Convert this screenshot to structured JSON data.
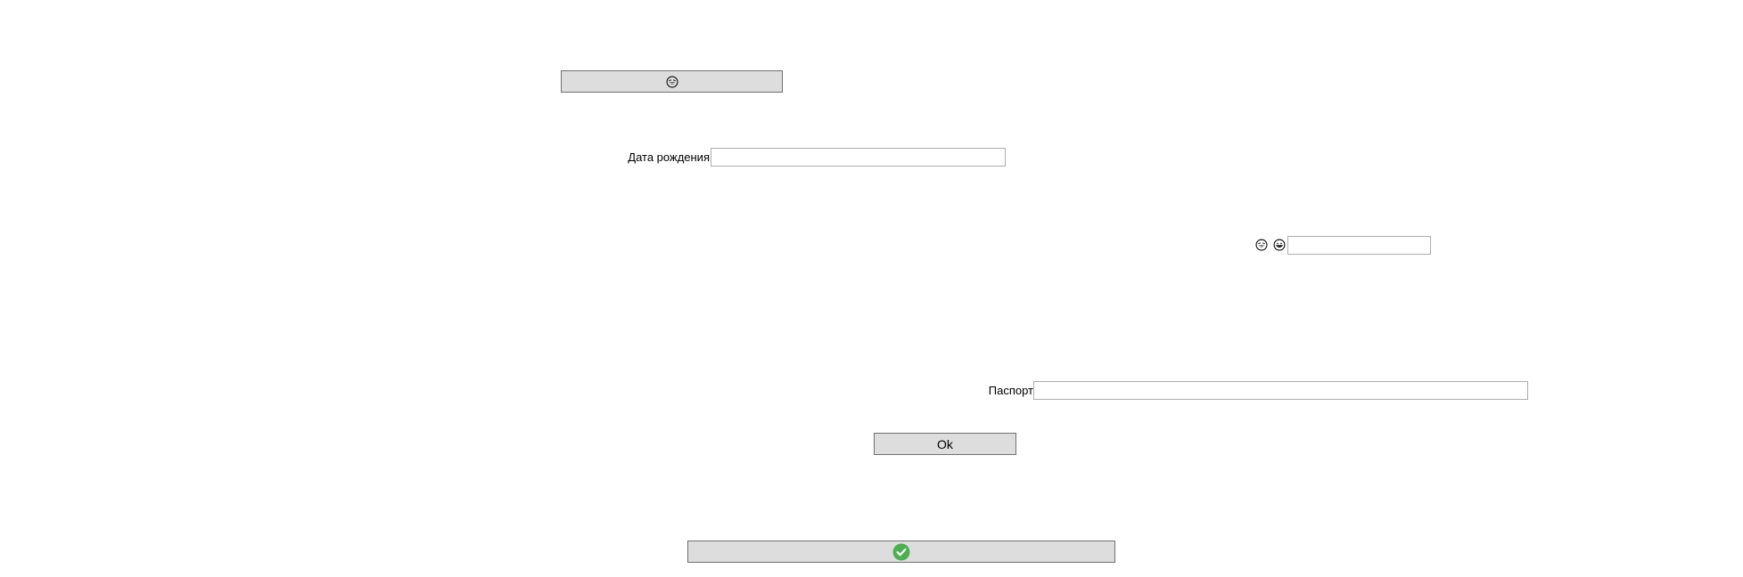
{
  "top_button": {
    "icon": "laughing-face-icon"
  },
  "birth_date": {
    "label": "Дата рождения",
    "value": "",
    "placeholder": ""
  },
  "emoji_field": {
    "icons": [
      "laughing-face-icon",
      "grinning-face-icon"
    ],
    "value": "",
    "placeholder": ""
  },
  "passport": {
    "label": "Паспорт",
    "value": "",
    "placeholder": ""
  },
  "ok_button": {
    "label": "Ok"
  },
  "confirm_button": {
    "icon": "green-check-circle-icon",
    "icon_color": "#4caf50"
  },
  "colors": {
    "button_bg": "#dddddd",
    "button_border": "#707070",
    "field_border": "#abadb3"
  }
}
